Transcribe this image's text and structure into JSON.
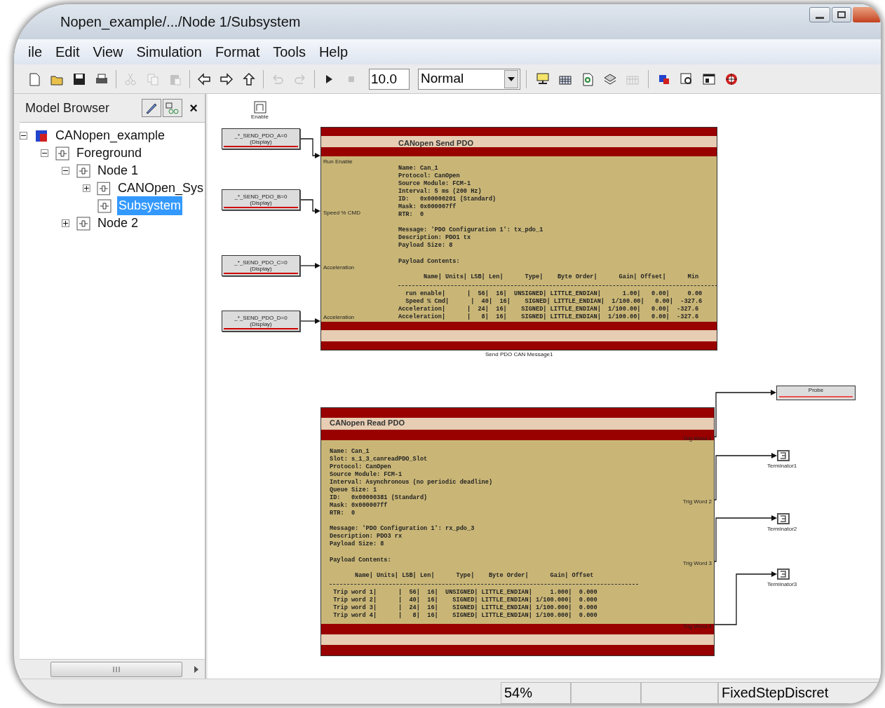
{
  "window": {
    "title": "Nopen_example/.../Node 1/Subsystem"
  },
  "menu": [
    "ile",
    "Edit",
    "View",
    "Simulation",
    "Format",
    "Tools",
    "Help"
  ],
  "toolbar": {
    "buttons": [
      {
        "disabled": false
      },
      {
        "disabled": false
      },
      {
        "disabled": false
      },
      {
        "disabled": false
      },
      {
        "disabled": true
      },
      {
        "disabled": true
      },
      {
        "disabled": true
      },
      {
        "disabled": false
      },
      {
        "disabled": false
      },
      {
        "disabled": false
      },
      {
        "disabled": true
      },
      {
        "disabled": true
      },
      {
        "disabled": false
      },
      {
        "disabled": true
      }
    ],
    "stop_time": "10.0",
    "mode": "Normal",
    "tools": [
      {
        "disabled": false
      },
      {
        "disabled": false
      },
      {
        "disabled": false
      },
      {
        "disabled": false
      },
      {
        "disabled": true
      },
      {
        "disabled": false
      },
      {
        "disabled": false
      },
      {
        "disabled": false
      },
      {
        "disabled": false
      }
    ]
  },
  "model_browser": {
    "title": "Model Browser",
    "close": "×",
    "tree": [
      {
        "label": "CANopen_example",
        "expanded": true,
        "selected": false,
        "kind": "model",
        "children": [
          {
            "label": "Foreground",
            "expanded": true,
            "selected": false,
            "kind": "subsystem",
            "children": [
              {
                "label": "Node 1",
                "expanded": true,
                "selected": false,
                "kind": "subsystem",
                "children": [
                  {
                    "label": "CANOpen_Sys",
                    "expanded": false,
                    "selected": false,
                    "kind": "subsystem",
                    "has_children": true
                  },
                  {
                    "label": "Subsystem",
                    "selected": true,
                    "kind": "subsystem",
                    "has_children": false
                  }
                ]
              },
              {
                "label": "Node 2",
                "expanded": false,
                "selected": false,
                "kind": "subsystem",
                "has_children": true
              }
            ]
          }
        ]
      }
    ]
  },
  "canvas": {
    "enable_block": {
      "label": "Enable"
    },
    "display_blocks": [
      {
        "name": "_*_SEND_PDO_A=0",
        "subtitle": "(Display)"
      },
      {
        "name": "_*_SEND_PDO_B=0",
        "subtitle": "(Display)"
      },
      {
        "name": "_*_SEND_PDO_C=0",
        "subtitle": "(Display)"
      },
      {
        "name": "_*_SEND_PDO_D=0",
        "subtitle": "(Display)"
      }
    ],
    "send_block": {
      "title": "CANopen Send PDO",
      "caption": "Send PDO CAN Message1",
      "ports": [
        "Run Enable",
        "Speed % CMD",
        "Acceleration",
        "Acceleration"
      ],
      "info_lines": [
        "Name: Can_1",
        "Protocol: CanOpen",
        "Source Module: FCM-1",
        "Interval: 5 ms (200 Hz)",
        "ID:   0x00000201 (Standard)",
        "Mask: 0x000007ff",
        "RTR:  0"
      ],
      "message_lines": [
        "Message: 'PDO Configuration 1': tx_pdo_1",
        "Description: PDO1 tx",
        "Payload Size: 8"
      ],
      "payload_label": "Payload Contents:",
      "table_header": "       Name| Units| LSB| Len|      Type|    Byte Order|      Gain| Offset|      Min",
      "table_rows": [
        "  run enable|      |  56|  16|  UNSIGNED| LITTLE_ENDIAN|      1.00|   0.00|     0.00",
        "  Speed % Cmd|      |  40|  16|    SIGNED| LITTLE_ENDIAN|  1/100.00|   0.00|  -327.6",
        "Acceleration|      |  24|  16|    SIGNED| LITTLE_ENDIAN|  1/100.00|   0.00|  -327.6",
        "Acceleration|      |   8|  16|    SIGNED| LITTLE_ENDIAN|  1/100.00|   0.00|  -327.6"
      ]
    },
    "read_block": {
      "title": "CANopen Read PDO",
      "ports": [
        "Trig Word 1",
        "Trig Word 2",
        "Trig Word 3",
        "Trig Word 4"
      ],
      "info_lines": [
        "Name: Can_1",
        "Slot: s_1_3_canreadPDO_Slot",
        "Protocol: CanOpen",
        "Source Module: FCM-1",
        "Interval: Asynchronous (no periodic deadline)",
        "Queue Size: 1",
        "ID:   0x00000381 (Standard)",
        "Mask: 0x000007ff",
        "RTR:  0"
      ],
      "message_lines": [
        "Message: 'PDO Configuration 1': rx_pdo_3",
        "Description: PDO3 rx",
        "Payload Size: 8"
      ],
      "payload_label": "Payload Contents:",
      "table_header": "       Name| Units| LSB| Len|      Type|    Byte Order|      Gain| Offset",
      "table_rows": [
        " Trip word 1|      |  56|  16|  UNSIGNED| LITTLE_ENDIAN|     1.000|  0.000",
        " Trip word 2|      |  40|  16|    SIGNED| LITTLE_ENDIAN| 1/100.000|  0.000",
        " Trip word 3|      |  24|  16|    SIGNED| LITTLE_ENDIAN| 1/100.000|  0.000",
        " Trip word 4|      |   8|  16|    SIGNED| LITTLE_ENDIAN| 1/100.000|  0.000"
      ]
    },
    "probe": {
      "label": "Probe"
    },
    "terminators": [
      "Terminator1",
      "Terminator2",
      "Terminator3"
    ]
  },
  "status_bar": {
    "zoom": "54%",
    "solver": "FixedStepDiscret"
  }
}
